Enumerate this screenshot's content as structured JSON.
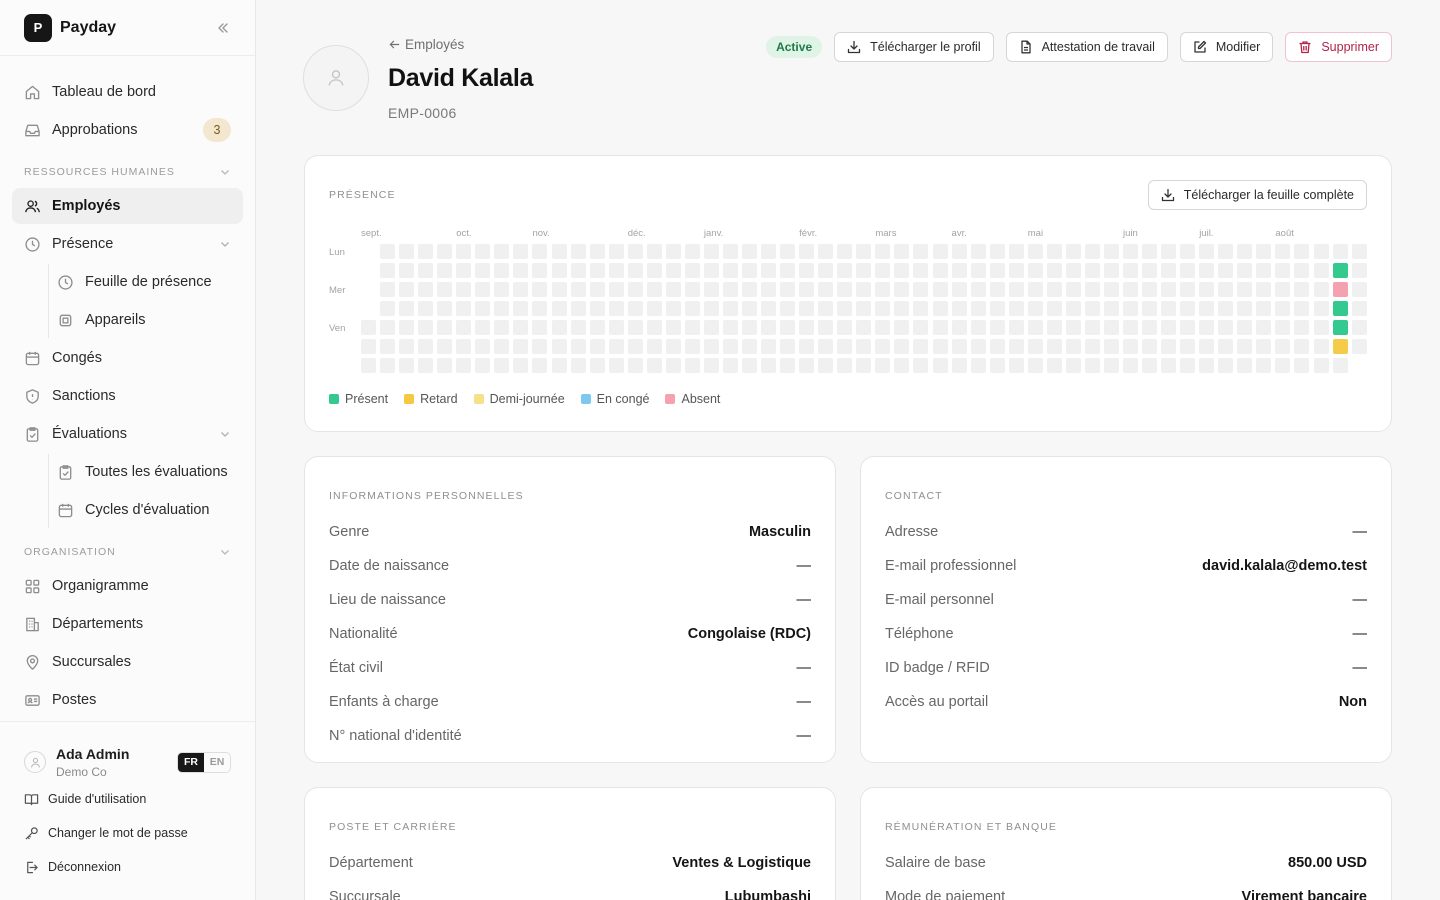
{
  "app": {
    "logo_letter": "P",
    "name": "Payday"
  },
  "nav": {
    "dashboard": "Tableau de bord",
    "approvals": "Approbations",
    "approvals_count": "3",
    "section_hr": "RESSOURCES HUMAINES",
    "employees": "Employés",
    "presence": "Présence",
    "timesheet": "Feuille de présence",
    "devices": "Appareils",
    "leave": "Congés",
    "sanctions": "Sanctions",
    "evaluations": "Évaluations",
    "all_evaluations": "Toutes les évaluations",
    "evaluation_cycles": "Cycles d'évaluation",
    "section_org": "ORGANISATION",
    "org_chart": "Organigramme",
    "departments": "Départements",
    "branches": "Succursales",
    "positions": "Postes"
  },
  "footer": {
    "user_name": "Ada Admin",
    "user_org": "Demo Co",
    "lang_fr": "FR",
    "lang_en": "EN",
    "guide": "Guide d'utilisation",
    "change_password": "Changer le mot de passe",
    "logout": "Déconnexion"
  },
  "header": {
    "back": "Employés",
    "name": "David Kalala",
    "emp_id": "EMP-0006",
    "status": "Active",
    "download_profile": "Télécharger le profil",
    "work_certificate": "Attestation de travail",
    "edit": "Modifier",
    "delete": "Supprimer"
  },
  "presence": {
    "title": "PRÉSENCE",
    "download_sheet": "Télécharger la feuille complète",
    "months": [
      "sept.",
      "oct.",
      "nov.",
      "déc.",
      "janv.",
      "févr.",
      "mars",
      "avr.",
      "mai",
      "juin",
      "juil.",
      "août"
    ],
    "month_week_index": [
      0,
      5,
      9,
      14,
      18,
      23,
      27,
      31,
      35,
      40,
      44,
      48
    ],
    "days": [
      "Lun",
      "Mer",
      "Ven"
    ],
    "weeks": 53,
    "marked": [
      {
        "week": 51,
        "day": 1,
        "status": "present"
      },
      {
        "week": 51,
        "day": 2,
        "status": "absent"
      },
      {
        "week": 51,
        "day": 3,
        "status": "present"
      },
      {
        "week": 51,
        "day": 4,
        "status": "present"
      },
      {
        "week": 51,
        "day": 5,
        "status": "late"
      }
    ],
    "legend": [
      {
        "label": "Présent",
        "color": "#34c98f"
      },
      {
        "label": "Retard",
        "color": "#f5c842"
      },
      {
        "label": "Demi-journée",
        "color": "#f7e08a"
      },
      {
        "label": "En congé",
        "color": "#7ec8f0"
      },
      {
        "label": "Absent",
        "color": "#f4a1b0"
      }
    ],
    "colors": {
      "present": "#34c98f",
      "late": "#f5cc4a",
      "absent": "#f4a1b0",
      "empty": "#f0f0f0"
    }
  },
  "personal": {
    "title": "INFORMATIONS PERSONNELLES",
    "rows": [
      {
        "label": "Genre",
        "value": "Masculin"
      },
      {
        "label": "Date de naissance",
        "value": "—"
      },
      {
        "label": "Lieu de naissance",
        "value": "—"
      },
      {
        "label": "Nationalité",
        "value": "Congolaise (RDC)"
      },
      {
        "label": "État civil",
        "value": "—"
      },
      {
        "label": "Enfants à charge",
        "value": "—"
      },
      {
        "label": "N° national d'identité",
        "value": "—"
      }
    ]
  },
  "contact": {
    "title": "CONTACT",
    "rows": [
      {
        "label": "Adresse",
        "value": "—"
      },
      {
        "label": "E-mail professionnel",
        "value": "david.kalala@demo.test"
      },
      {
        "label": "E-mail personnel",
        "value": "—"
      },
      {
        "label": "Téléphone",
        "value": "—"
      },
      {
        "label": "ID badge / RFID",
        "value": "—"
      },
      {
        "label": "Accès au portail",
        "value": "Non"
      }
    ]
  },
  "career": {
    "title": "POSTE ET CARRIÈRE",
    "rows": [
      {
        "label": "Département",
        "value": "Ventes & Logistique"
      },
      {
        "label": "Succursale",
        "value": "Lubumbashi"
      }
    ]
  },
  "pay": {
    "title": "RÉMUNÉRATION ET BANQUE",
    "rows": [
      {
        "label": "Salaire de base",
        "value": "850.00 USD"
      },
      {
        "label": "Mode de paiement",
        "value": "Virement bancaire"
      }
    ]
  }
}
